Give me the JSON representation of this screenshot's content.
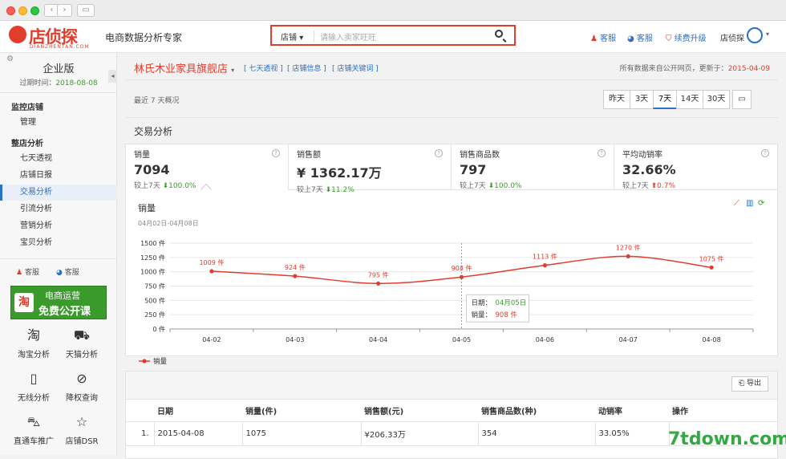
{
  "header": {
    "logo_text": "店侦探",
    "logo_sub": "DIANZHENTAN.COM",
    "slogan": "电商数据分析专家",
    "search_category": "店铺",
    "search_placeholder": "请输入卖家旺旺",
    "links": [
      "客服",
      "客服",
      "续费升级",
      "店侦探"
    ]
  },
  "sidebar": {
    "edition": "企业版",
    "expire_label": "过期时间：",
    "expire_date": "2018-08-08",
    "monitor_title": "监控店铺",
    "monitor_items": [
      "管理"
    ],
    "analysis_title": "整店分析",
    "analysis_items": [
      "七天透视",
      "店铺日报",
      "交易分析",
      "引流分析",
      "营销分析",
      "宝贝分析"
    ],
    "service_links": [
      "客服",
      "客服"
    ],
    "banner_line1": "电商运营",
    "banner_line2": "免费公开课",
    "banner_badge": "淘",
    "tools": [
      {
        "label": "淘宝分析",
        "icon": "taobao-icon",
        "glyph": "淘"
      },
      {
        "label": "天猫分析",
        "icon": "tmall-icon",
        "glyph": "⛟"
      },
      {
        "label": "无线分析",
        "icon": "mobile-icon",
        "glyph": "▯"
      },
      {
        "label": "降权查询",
        "icon": "eye-off-icon",
        "glyph": "⊘"
      },
      {
        "label": "直通车推广",
        "icon": "car-icon",
        "glyph": "⛍"
      },
      {
        "label": "店铺DSR",
        "icon": "star-icon",
        "glyph": "☆"
      }
    ]
  },
  "shop": {
    "name": "林氏木业家具旗舰店",
    "links": [
      "[ 七天透视 ]",
      "[ 店铺信息 ]",
      "[ 店铺关键词 ]"
    ],
    "update_prefix": "所有数据来自公开网页，更新于：",
    "update_date": "2015-04-09"
  },
  "overview": {
    "label": "最近 7 天概况",
    "ranges": [
      "昨天",
      "3天",
      "7天",
      "14天",
      "30天"
    ],
    "active_range": "7天",
    "calendar_icon": "calendar-icon"
  },
  "section_title": "交易分析",
  "metrics": [
    {
      "label": "销量",
      "value": "7094",
      "compare": "较上7天",
      "change": "100.0%",
      "dir": "down",
      "arrow": "⬇"
    },
    {
      "label": "销售额",
      "value": "¥ 1362.17万",
      "compare": "较上7天",
      "change": "11.2%",
      "dir": "down",
      "arrow": "⬇"
    },
    {
      "label": "销售商品数",
      "value": "797",
      "compare": "较上7天",
      "change": "100.0%",
      "dir": "down",
      "arrow": "⬇"
    },
    {
      "label": "平均动销率",
      "value": "32.66%",
      "compare": "较上7天",
      "change": "0.7%",
      "dir": "up",
      "arrow": "⬆"
    }
  ],
  "chart_data": {
    "type": "line",
    "title": "销量",
    "subtitle": "04月02日-04月08日",
    "categories": [
      "04-02",
      "04-03",
      "04-04",
      "04-05",
      "04-06",
      "04-07",
      "04-08"
    ],
    "series": [
      {
        "name": "销量",
        "values": [
          1009,
          924,
          795,
          908,
          1113,
          1270,
          1075
        ],
        "color": "#e23d2c"
      }
    ],
    "data_labels": [
      "1009 件",
      "924 件",
      "795 件",
      "908 件",
      "1113 件",
      "1270 件",
      "1075 件"
    ],
    "yticks": [
      "1500 件",
      "1250 件",
      "1000 件",
      "750 件",
      "500 件",
      "250 件",
      "0 件"
    ],
    "ylim": [
      0,
      1500
    ],
    "grid": true,
    "legend": "bottom-left",
    "tooltip": {
      "date_label": "日期：",
      "date": "04月05日",
      "sales_label": "销量：",
      "sales": "908 件"
    }
  },
  "table": {
    "export_label": "导出",
    "headers": [
      "日期",
      "销量(件)",
      "销售额(元)",
      "销售商品数(种)",
      "动销率",
      "操作"
    ],
    "rows": [
      [
        "1.",
        "2015-04-08",
        "1075",
        "¥206.33万",
        "354",
        "33.05%",
        ""
      ]
    ]
  },
  "watermark": "7tdown.com"
}
